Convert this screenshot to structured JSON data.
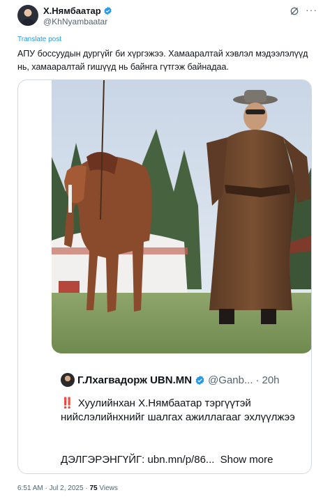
{
  "post": {
    "author_name": "Х.Нямбаатар",
    "author_handle": "@KhNyambaatar",
    "translate_label": "Translate post",
    "text": "АПУ боссуудын дургүйг би хүргэжээ. Хамааралтай хэвлэл мэдээлэлүүд нь, хамааралтай гишүүд нь байнга гүтгэж байнадаа.",
    "icons": [
      "avatar",
      "verified-badge-icon",
      "grok-icon",
      "more-icon"
    ]
  },
  "quote": {
    "author_name": "Г.Лхагвадорж UBN.MN",
    "author_handle": "@Ganb...",
    "separator": "·",
    "time": "20h",
    "alert_glyph": "‼️",
    "body": "Хуулийнхан Х.Нямбаатар тэргүүтэй нийслэлийнхнийг шалгах ажиллагааг эхлүүлжээ",
    "link_text": "ДЭЛГЭРЭНГҮЙГ: ubn.mn/p/86...",
    "show_more": "Show more"
  },
  "meta": {
    "time": "6:51 AM",
    "dot1": "·",
    "date": "Jul 2, 2025",
    "dot2": "·",
    "views_count": "75",
    "views_label": "Views"
  },
  "colors": {
    "link_blue": "#1d9bf0",
    "text": "#0f1419",
    "secondary": "#536471",
    "border": "#cfd9de",
    "verified": "#1d9bf0"
  }
}
